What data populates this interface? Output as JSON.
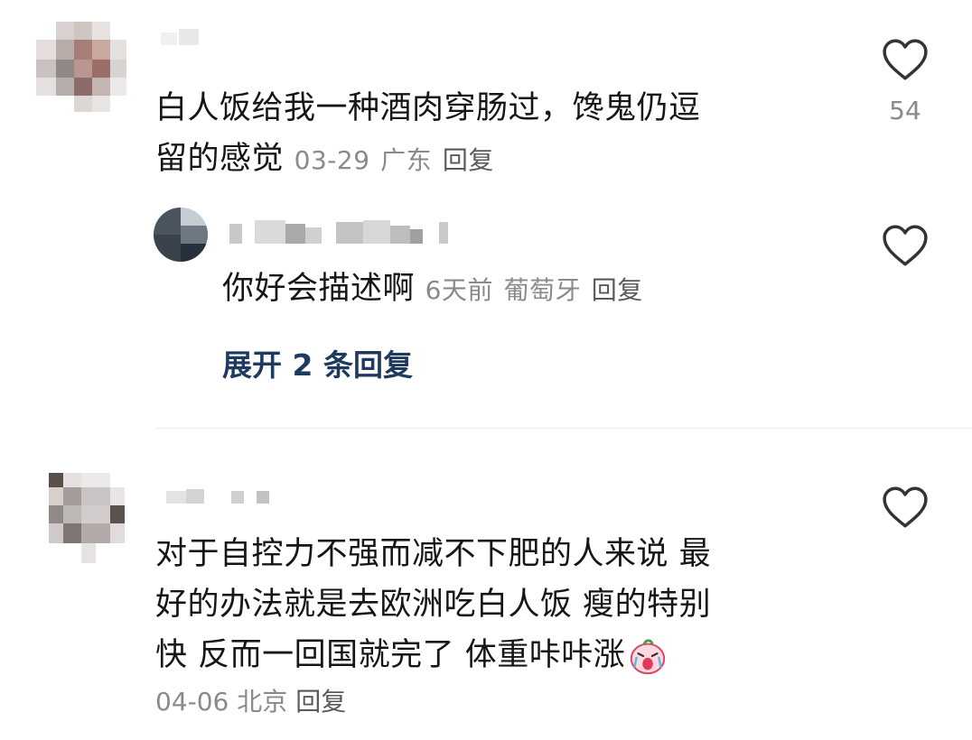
{
  "comments": [
    {
      "text_line1": "白人饭给我一种酒肉穿肠过，馋鬼仍逗",
      "text_line2": "留的感觉",
      "date": "03-29",
      "location": "广东",
      "reply_label": "回复",
      "like_count": "54",
      "replies": [
        {
          "text": "你好会描述啊",
          "date": "6天前",
          "location": "葡萄牙",
          "reply_label": "回复"
        }
      ],
      "expand_label": "展开 2 条回复"
    },
    {
      "text_line1": "对于自控力不强而减不下肥的人来说 最",
      "text_line2": "好的办法就是去欧洲吃白人饭 瘦的特别",
      "text_line3": "快 反而一回国就完了 体重咔咔涨",
      "emoji_name": "crying-peach-emoji",
      "date": "04-06",
      "location": "北京",
      "reply_label": "回复"
    }
  ],
  "colors": {
    "text": "#161616",
    "meta": "#8a8a8a",
    "expand_link": "#1f3a5f",
    "divider": "#ececec"
  }
}
